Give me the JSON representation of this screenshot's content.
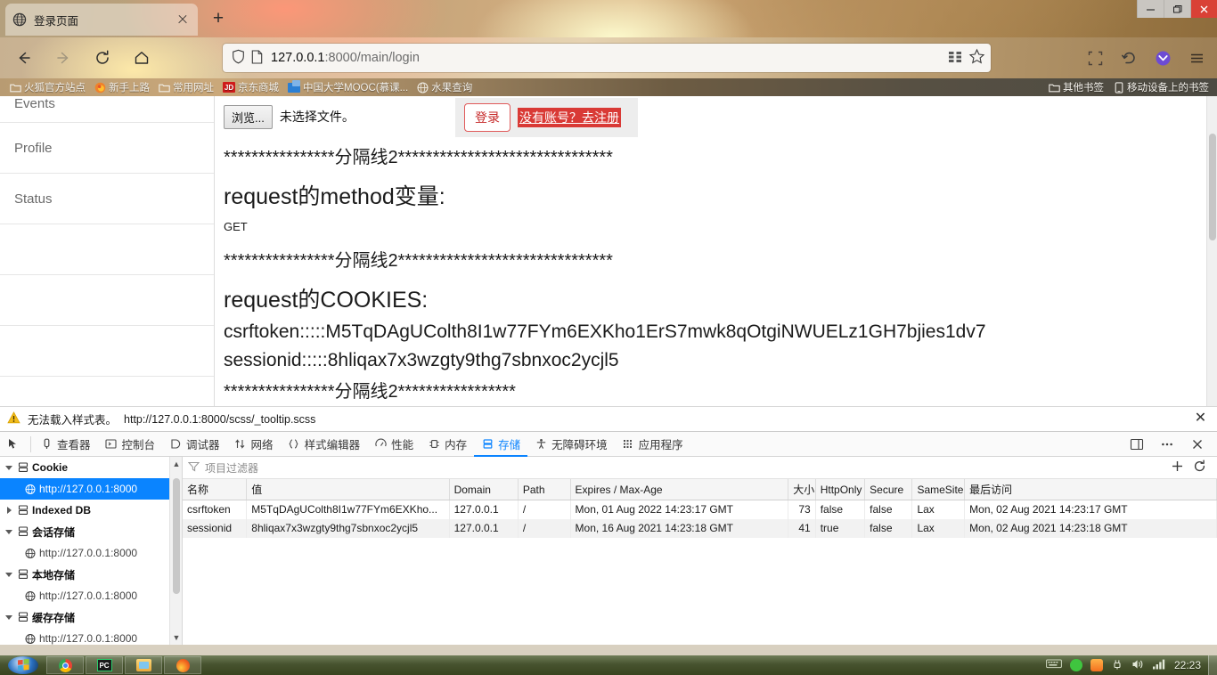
{
  "window": {
    "minimize_label": "—",
    "restore_label": "❐",
    "close_label": "✕"
  },
  "tab": {
    "title": "登录页面",
    "favicon": "globe-icon",
    "close_label": "",
    "newtab_label": "+"
  },
  "nav": {
    "back_icon": "back-arrow-icon",
    "forward_icon": "forward-arrow-icon",
    "reload_icon": "reload-icon",
    "home_icon": "home-icon",
    "url": "127.0.0.1:8000/main/login",
    "url_host": "127.0.0.1",
    "url_path": ":8000/main/login",
    "shield_icon": "shield-icon",
    "page_icon": "page-doc-icon",
    "reader_icon": "reader-view-icon",
    "bookmark_star_icon": "star-icon",
    "screenshot_icon": "screenshot-icon",
    "undo_icon": "undo-icon",
    "pocket_icon": "pocket-icon",
    "menu_icon": "hamburger-menu-icon"
  },
  "bookmarks": {
    "items": [
      {
        "label": "火狐官方站点",
        "icon": "folder-icon"
      },
      {
        "label": "新手上路",
        "icon": "firefox-icon"
      },
      {
        "label": "常用网址",
        "icon": "folder-icon"
      },
      {
        "label": "京东商城",
        "icon": "jd-icon"
      },
      {
        "label": "中国大学MOOC(慕课...",
        "icon": "mooc-icon"
      },
      {
        "label": "水果查询",
        "icon": "globe-icon"
      }
    ],
    "right_items": [
      {
        "label": "其他书签",
        "icon": "folder-icon"
      },
      {
        "label": "移动设备上的书签",
        "icon": "mobile-icon"
      }
    ]
  },
  "page": {
    "sidebar_items": [
      "Events",
      "Profile",
      "Status"
    ],
    "file_input": {
      "browse_label": "浏览...",
      "no_file_text": "未选择文件。"
    },
    "login_button_label": "登录",
    "register_link_label": "没有账号？去注册",
    "separator_1": "****************分隔线2*******************************",
    "method_heading": "request的method变量:",
    "method_value": "GET",
    "separator_2": "****************分隔线2*******************************",
    "cookies_heading": "request的COOKIES:",
    "cookie_csrftoken_line": "csrftoken:::::M5TqDAgUColth8I1w77FYm6EXKho1ErS7mwk8qOtgiNWUELz1GH7bjies1dv7",
    "cookie_sessionid_line": "sessionid:::::8hliqax7x3wzgty9thg7sbnxoc2ycjl5",
    "separator_3_partial": "****************分隔线2*****************"
  },
  "notification": {
    "icon": "warning-triangle-icon",
    "message": "无法载入样式表。",
    "url": "http://127.0.0.1:8000/scss/_tooltip.scss",
    "close_label": "✕"
  },
  "devtools": {
    "picker_icon": "element-picker-icon",
    "tabs": [
      {
        "label": "查看器",
        "icon": "inspector-icon",
        "active": false
      },
      {
        "label": "控制台",
        "icon": "console-icon",
        "active": false
      },
      {
        "label": "调试器",
        "icon": "debugger-icon",
        "active": false
      },
      {
        "label": "网络",
        "icon": "network-icon",
        "active": false
      },
      {
        "label": "样式编辑器",
        "icon": "style-editor-icon",
        "active": false
      },
      {
        "label": "性能",
        "icon": "performance-icon",
        "active": false
      },
      {
        "label": "内存",
        "icon": "memory-icon",
        "active": false
      },
      {
        "label": "存储",
        "icon": "storage-icon",
        "active": true
      },
      {
        "label": "无障碍环境",
        "icon": "accessibility-icon",
        "active": false
      },
      {
        "label": "应用程序",
        "icon": "application-icon",
        "active": false
      }
    ],
    "toolbar_right": {
      "dock_icon": "dock-split-icon",
      "more_icon": "ellipsis-icon",
      "close_icon": "close-icon"
    },
    "accent_color": "#0b84ff",
    "storage_tree": [
      {
        "label": "Cookie",
        "type": "group",
        "expanded": true,
        "icon": "storage-db-icon"
      },
      {
        "label": "http://127.0.0.1:8000",
        "type": "child",
        "selected": true,
        "icon": "globe-icon"
      },
      {
        "label": "Indexed DB",
        "type": "group",
        "expanded": false,
        "icon": "storage-db-icon"
      },
      {
        "label": "会话存储",
        "type": "group",
        "expanded": true,
        "icon": "storage-db-icon"
      },
      {
        "label": "http://127.0.0.1:8000",
        "type": "child",
        "selected": false,
        "icon": "globe-icon"
      },
      {
        "label": "本地存储",
        "type": "group",
        "expanded": true,
        "icon": "storage-db-icon"
      },
      {
        "label": "http://127.0.0.1:8000",
        "type": "child",
        "selected": false,
        "icon": "globe-icon"
      },
      {
        "label": "缓存存储",
        "type": "group",
        "expanded": true,
        "icon": "storage-db-icon"
      },
      {
        "label": "http://127.0.0.1:8000",
        "type": "child",
        "selected": false,
        "icon": "globe-icon"
      }
    ],
    "filter": {
      "icon": "filter-icon",
      "placeholder": "项目过滤器",
      "add_label": "+",
      "refresh_icon": "refresh-icon"
    },
    "table": {
      "columns": [
        "名称",
        "值",
        "Domain",
        "Path",
        "Expires / Max-Age",
        "大小",
        "HttpOnly",
        "Secure",
        "SameSite",
        "最后访问"
      ],
      "rows": [
        {
          "name": "csrftoken",
          "value": "M5TqDAgUColth8I1w77FYm6EXKho...",
          "domain": "127.0.0.1",
          "path": "/",
          "expires": "Mon, 01 Aug 2022 14:23:17 GMT",
          "size": "73",
          "httponly": "false",
          "secure": "false",
          "samesite": "Lax",
          "last_accessed": "Mon, 02 Aug 2021 14:23:17 GMT"
        },
        {
          "name": "sessionid",
          "value": "8hliqax7x3wzgty9thg7sbnxoc2ycjl5",
          "domain": "127.0.0.1",
          "path": "/",
          "expires": "Mon, 16 Aug 2021 14:23:18 GMT",
          "size": "41",
          "httponly": "true",
          "secure": "false",
          "samesite": "Lax",
          "last_accessed": "Mon, 02 Aug 2021 14:23:18 GMT"
        }
      ]
    }
  },
  "taskbar": {
    "start_icon": "windows-start-icon",
    "items": [
      {
        "icon": "chrome-icon"
      },
      {
        "icon": "pc-manager-icon"
      },
      {
        "icon": "file-explorer-icon"
      },
      {
        "icon": "firefox-icon"
      }
    ],
    "tray": [
      {
        "icon": "keyboard-icon"
      },
      {
        "icon": "wechat-icon"
      },
      {
        "icon": "sogou-input-icon"
      },
      {
        "icon": "usb-icon"
      },
      {
        "icon": "volume-icon"
      },
      {
        "icon": "network-signal-icon"
      }
    ],
    "clock": "22:23"
  }
}
